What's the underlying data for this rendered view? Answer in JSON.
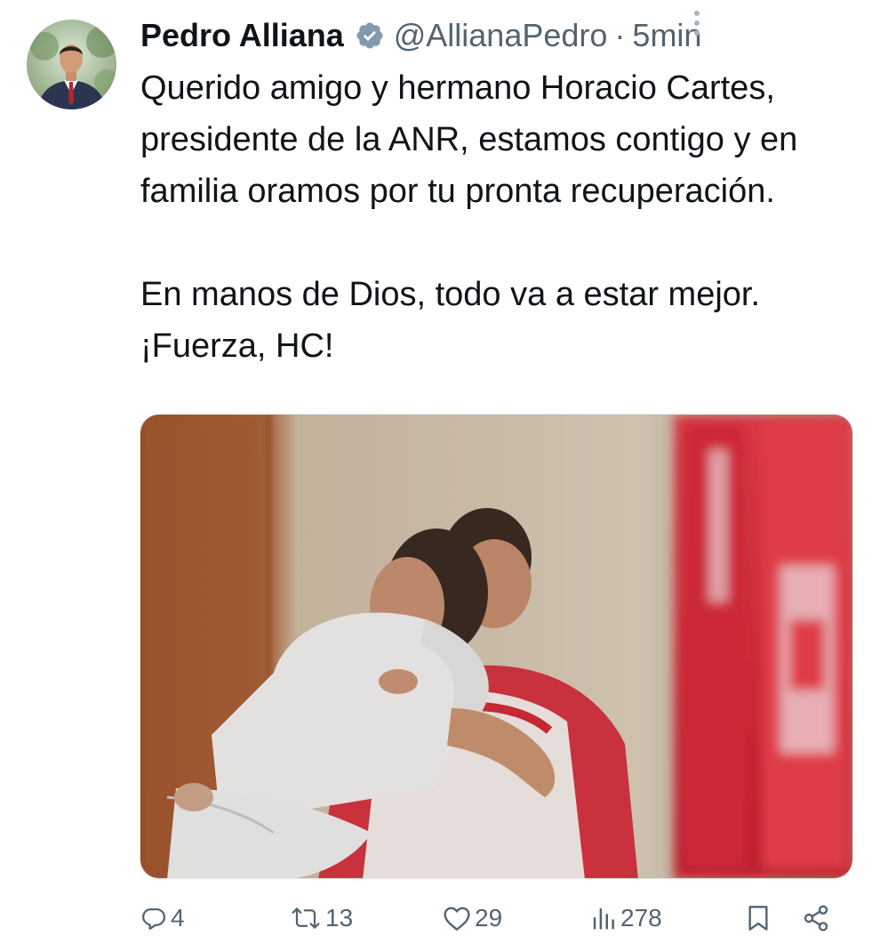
{
  "author": {
    "name": "Pedro Alliana",
    "handle": "@AllianaPedro",
    "separator": "·",
    "time": "5min",
    "verified": true
  },
  "tweet": {
    "paragraphs": [
      "Querido amigo y hermano Horacio Cartes, presidente de la ANR, estamos contigo y en familia oramos por tu pronta recuperación.",
      "En manos de Dios, todo va a estar mejor. ¡Fuerza, HC!"
    ]
  },
  "metrics": {
    "replies": "4",
    "retweets": "13",
    "likes": "29",
    "views": "278"
  },
  "icons": {
    "verified": "verified-badge-icon",
    "more": "more-vertical-icon",
    "reply": "reply-icon",
    "retweet": "retweet-icon",
    "like": "heart-icon",
    "views": "views-icon",
    "bookmark": "bookmark-icon",
    "share": "share-icon"
  },
  "colors": {
    "text": "#0f1419",
    "secondary": "#536471",
    "badge": "#829aab"
  }
}
